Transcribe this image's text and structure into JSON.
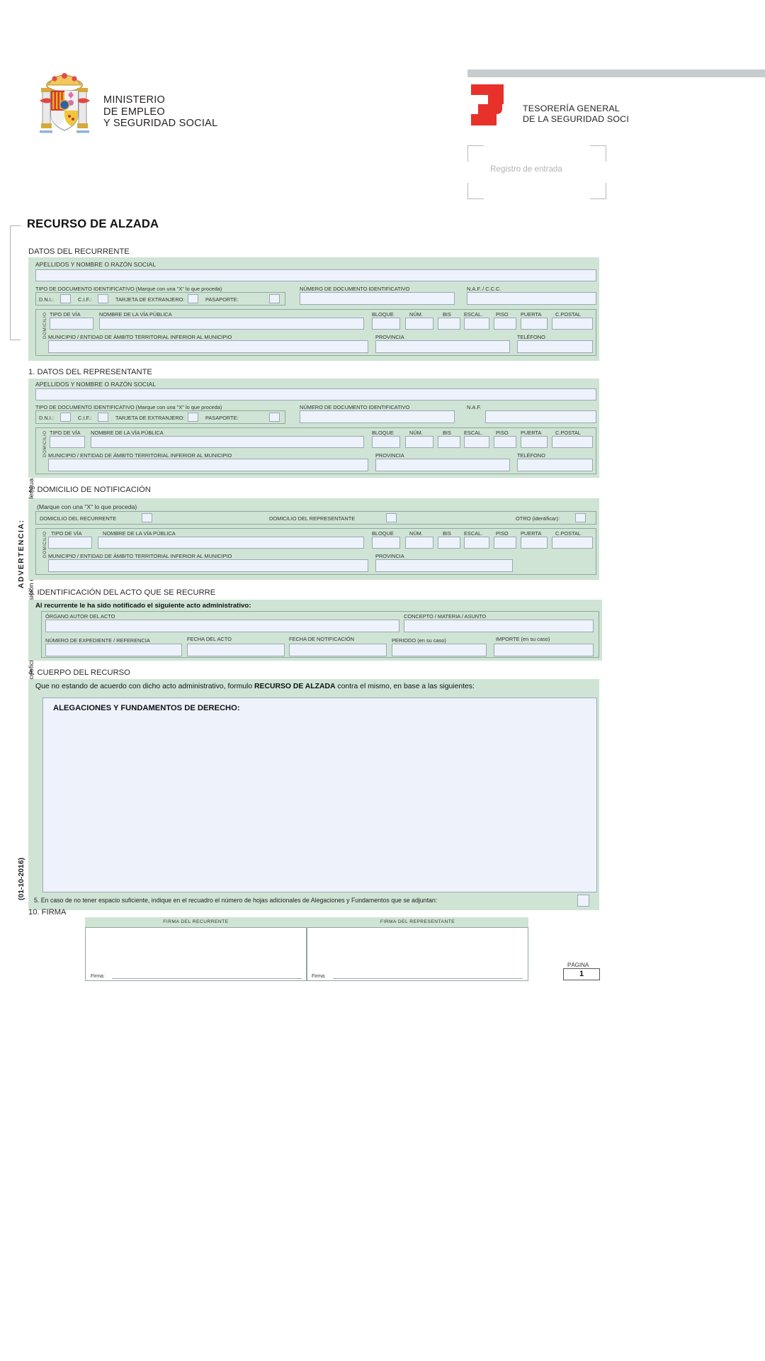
{
  "header": {
    "ministry_lines": [
      "MINISTERIO",
      "DE EMPLEO",
      "Y SEGURIDAD SOCIAL"
    ],
    "agency_lines": [
      "TESORERÍA GENERAL",
      "DE LA SEGURIDAD SOCI"
    ],
    "entry_register_label": "Registro de entrada",
    "coat_of_arms_alt": "Escudo de España",
    "logo_alt": "Logotipo Tesorería General de la Seguridad Social"
  },
  "document": {
    "title": "RECURSO DE ALZADA",
    "page_label": "PÁGINA",
    "page_number": "1",
    "form_code": "(01-10-2016)"
  },
  "side_notes": {
    "advertencia": "ADVERTENCIA:",
    "line1": "En las Comunidades Autónomas con lengua cooficial, existe a su disposición este impreso redactado en lengua vernácula."
  },
  "common_labels": {
    "apellidos": "APELLIDOS Y NOMBRE O RAZÓN SOCIAL",
    "tipo_doc": "TIPO DE DOCUMENTO IDENTIFICATIVO (Marque con una \"X\" lo que proceda)",
    "dni": "D.N.I.:",
    "cif": "C.I.F.:",
    "tarjeta": "TARJETA DE EXTRANJERO:",
    "pasaporte": "PASAPORTE:",
    "num_doc": "NÚMERO DE DOCUMENTO IDENTIFICATIVO",
    "naf_ccc": "N.A.F. / C.C.C.",
    "naf": "N.A.F.",
    "domicilio_rot": "DOMICILIO",
    "tipo_via": "TIPO DE VÍA",
    "nombre_via": "NOMBRE DE LA VÍA PÚBLICA",
    "bloque": "BLOQUE",
    "num": "NÚM.",
    "bis": "BIS",
    "escal": "ESCAL.",
    "piso": "PISO",
    "puerta": "PUERTA",
    "cpostal": "C.POSTAL",
    "municipio": "MUNICIPIO / ENTIDAD DE ÁMBITO TERRITORIAL INFERIOR AL MUNICIPIO",
    "provincia": "PROVINCIA",
    "telefono": "TELÉFONO"
  },
  "section_recurrente": {
    "title": "DATOS DEL RECURRENTE"
  },
  "section_representante": {
    "title": "1. DATOS DEL REPRESENTANTE"
  },
  "section_notificacion": {
    "title": "2. DOMICILIO DE NOTIFICACIÓN",
    "marque": "(Marque con una \"X\" lo que proceda)",
    "dom_recurrente": "DOMICILIO DEL RECURRENTE",
    "dom_representante": "DOMICILIO DEL REPRESENTANTE",
    "otro": "OTRO (identificar):"
  },
  "section_acto": {
    "title": "3. IDENTIFICACIÓN DEL ACTO QUE SE RECURRE",
    "intro": "Al recurrente le ha sido notificado el siguiente acto administrativo:",
    "organo": "ÓRGANO AUTOR DEL ACTO",
    "concepto": "CONCEPTO / MATERIA / ASUNTO",
    "num_expediente": "NÚMERO DE EXPEDIENTE / REFERENCIA",
    "fecha_acto": "FECHA DEL ACTO",
    "fecha_notificacion": "FECHA DE NOTIFICACIÓN",
    "periodo": "PERIODO (en su caso)",
    "importe": "IMPORTE (en su caso)"
  },
  "section_cuerpo": {
    "title": "4. CUERPO DEL RECURSO",
    "statement_pre": "Que no estando de acuerdo con dicho acto administrativo, formulo ",
    "statement_bold": "RECURSO DE ALZADA",
    "statement_post": " contra el mismo, en base a las siguientes:",
    "alegaciones": "ALEGACIONES Y FUNDAMENTOS DE DERECHO:",
    "note5": "5. En caso de no tener espacio suficiente, indique en el recuadro el número de hojas adicionales de Alegaciones y Fundamentos que se adjuntan:"
  },
  "section_firma": {
    "title": "10. FIRMA",
    "firma_recurrente": "FIRMA DEL RECURRENTE",
    "firma_representante": "FIRMA DEL REPRESENTANTE",
    "firma_word": "Firma:"
  },
  "colors": {
    "panel_green": "#cfe4d4",
    "field_blue": "#eef2fb",
    "field_border": "#9aa7b8",
    "logo_red": "#e8312a",
    "bar_grey": "#c9ccce"
  }
}
